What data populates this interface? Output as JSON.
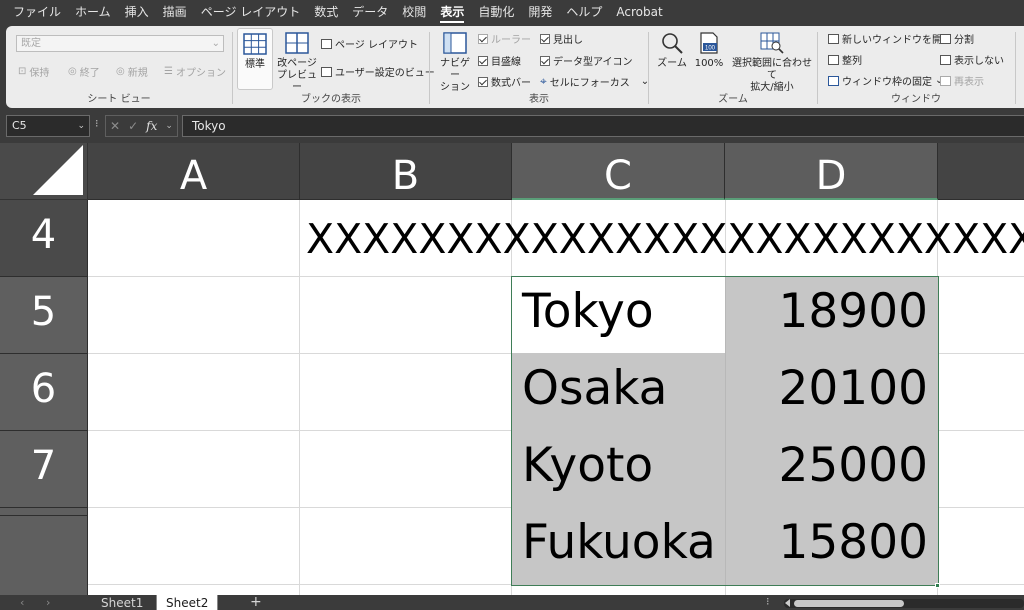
{
  "menu": [
    "ファイル",
    "ホーム",
    "挿入",
    "描画",
    "ページ レイアウト",
    "数式",
    "データ",
    "校閲",
    "表示",
    "自動化",
    "開発",
    "ヘルプ",
    "Acrobat"
  ],
  "active_menu": "表示",
  "ribbon": {
    "sheet_view": {
      "dropdown_value": "既定",
      "keep": "保持",
      "exit": "終了",
      "new": "新規",
      "options": "オプション",
      "label": "シート ビュー"
    },
    "workbook_views": {
      "normal": "標準",
      "page_break_line1": "改ページ",
      "page_break_line2": "プレビュー",
      "page_layout": "ページ レイアウト",
      "custom_views": "ユーザー設定のビュー",
      "label": "ブックの表示"
    },
    "show": {
      "navigation_line1": "ナビゲー",
      "navigation_line2": "ション",
      "ruler": "ルーラー",
      "gridlines": "目盛線",
      "formula_bar": "数式バー",
      "headings": "見出し",
      "data_type_icons": "データ型アイコン",
      "focus_cell": "セルにフォーカス",
      "label": "表示"
    },
    "zoom": {
      "zoom": "ズーム",
      "hundred": "100%",
      "zoom_to_selection_line1": "選択範囲に合わせて",
      "zoom_to_selection_line2": "拡大/縮小",
      "label": "ズーム",
      "hundred_icon": "100"
    },
    "window": {
      "new_window": "新しいウィンドウを開く",
      "arrange": "整列",
      "freeze_panes": "ウィンドウ枠の固定",
      "split": "分割",
      "hide": "表示しない",
      "unhide": "再表示",
      "label": "ウィンドウ"
    }
  },
  "formula_bar": {
    "name_box": "C5",
    "fx": "fx",
    "content": "Tokyo"
  },
  "grid": {
    "columns": [
      "A",
      "B",
      "C",
      "D"
    ],
    "rows": [
      "4",
      "5",
      "6",
      "7"
    ],
    "row4_text": "XXXXXXXXXXXXXXXXXXXXXXXXXXXXXXXXX",
    "data": [
      {
        "city": "Tokyo",
        "value": "18900"
      },
      {
        "city": "Osaka",
        "value": "20100"
      },
      {
        "city": "Kyoto",
        "value": "25000"
      },
      {
        "city": "Fukuoka",
        "value": "15800"
      }
    ]
  },
  "sheets": [
    "Sheet1",
    "Sheet2"
  ],
  "active_sheet": "Sheet2",
  "colors": {
    "selection_border": "#3f7d57",
    "selection_fill": "#c6c6c6",
    "dark_chrome": "#3b3b3b"
  }
}
